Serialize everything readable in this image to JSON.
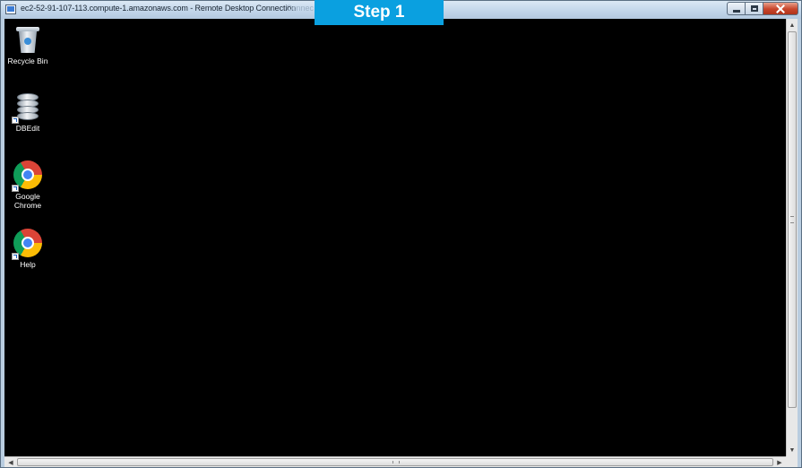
{
  "window": {
    "title": "ec2-52-91-107-113.compute-1.amazonaws.com - Remote Desktop Connection",
    "title_ghost": "Connec"
  },
  "banner": {
    "text": "Step 1"
  },
  "desktop": {
    "icons": [
      {
        "label": "Recycle Bin",
        "icon": "recycle-bin-icon"
      },
      {
        "label": "DBEdit",
        "icon": "database-icon"
      },
      {
        "label": "Google Chrome",
        "icon": "chrome-icon"
      },
      {
        "label": "Help",
        "icon": "chrome-icon"
      }
    ]
  },
  "colors": {
    "banner_bg": "#0aa0e0",
    "desktop_bg": "#000000",
    "titlebar": "#c2d6ea",
    "close_button": "#c8452b"
  }
}
